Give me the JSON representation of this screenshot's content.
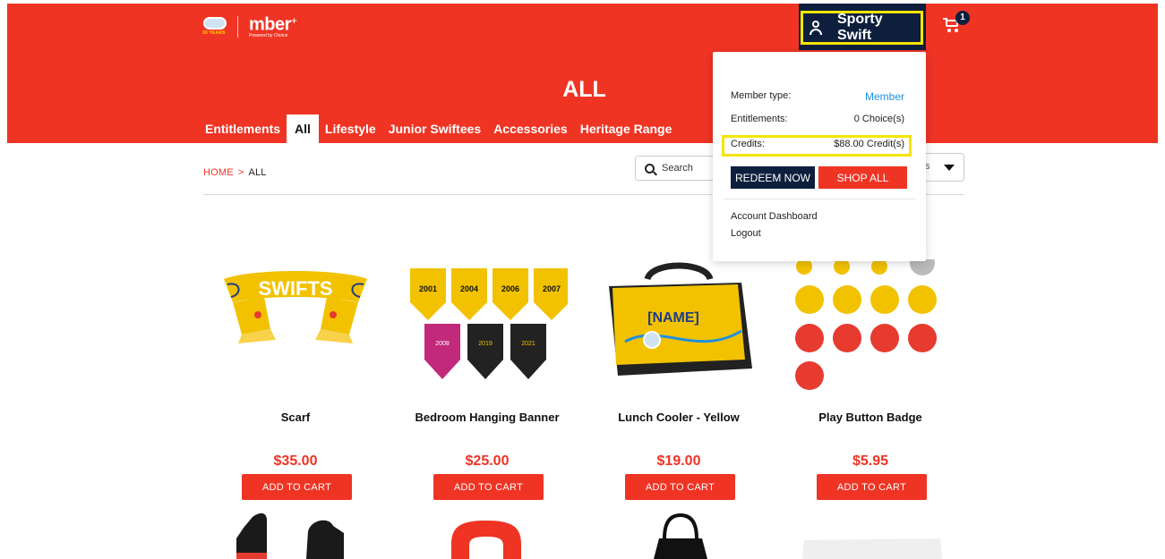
{
  "brand": {
    "badge_text": "30 YEARS",
    "name": "mber",
    "plus": "+",
    "tagline": "Powered by Choice"
  },
  "header": {
    "user_name": "Sporty Swift",
    "cart_count": "1",
    "page_title": "ALL"
  },
  "tabs": [
    {
      "label": "Entitlements"
    },
    {
      "label": "All"
    },
    {
      "label": "Lifestyle"
    },
    {
      "label": "Junior Swiftees"
    },
    {
      "label": "Accessories"
    },
    {
      "label": "Heritage Range"
    }
  ],
  "breadcrumb": {
    "home": "HOME",
    "separator": ">",
    "current": "ALL"
  },
  "search": {
    "label": "Search"
  },
  "sort": {
    "visible_text": "s"
  },
  "account_menu": {
    "member_type_label": "Member type:",
    "member_type_value": "Member",
    "entitlements_label": "Entitlements:",
    "entitlements_value": "0 Choice(s)",
    "credits_label": "Credits:",
    "credits_value": "$88.00 Credit(s)",
    "redeem_label": "REDEEM NOW",
    "shop_all_label": "SHOP ALL",
    "dashboard_label": "Account Dashboard",
    "logout_label": "Logout"
  },
  "products": [
    {
      "name": "Scarf",
      "price": "$35.00",
      "button": "ADD TO CART",
      "image_text": "SWIFTS"
    },
    {
      "name": "Bedroom Hanging Banner",
      "price": "$25.00",
      "button": "ADD TO CART",
      "image_text": [
        "2001",
        "2004",
        "2006",
        "2007",
        "2008",
        "2019",
        "2021"
      ]
    },
    {
      "name": "Lunch Cooler - Yellow",
      "price": "$19.00",
      "button": "ADD TO CART",
      "image_text": "[NAME]"
    },
    {
      "name": "Play Button Badge",
      "price": "$5.95",
      "button": "ADD TO CART"
    }
  ],
  "colors": {
    "brand_red": "#ef3424",
    "navy": "#0e1f3d",
    "highlight": "#f5e400",
    "link_blue": "#1f8fe0",
    "yellow": "#f2c200"
  }
}
